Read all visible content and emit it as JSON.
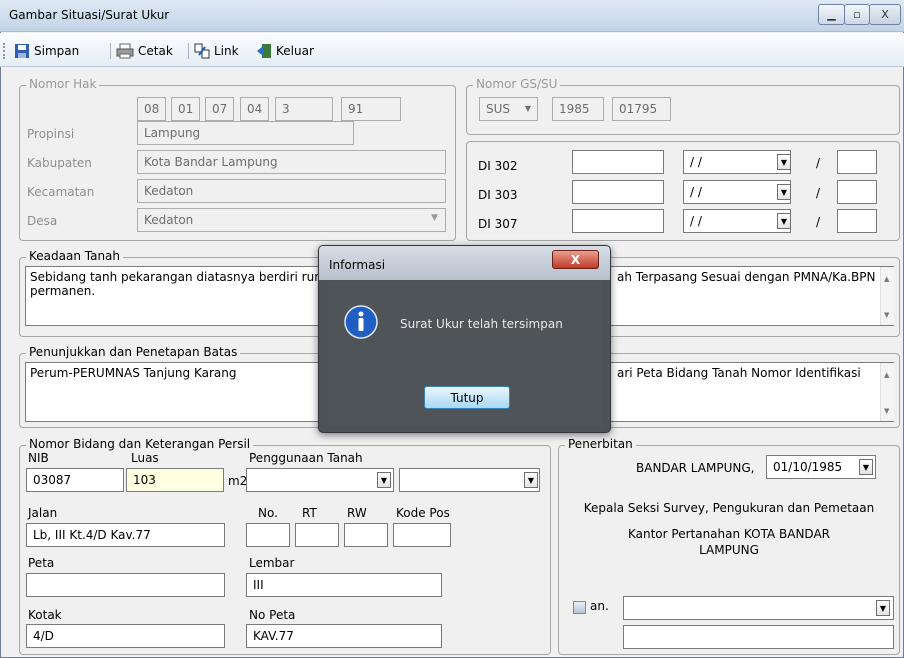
{
  "window": {
    "title": "Gambar Situasi/Surat Ukur",
    "minimize": "▁",
    "maximize": "▫",
    "close": "X"
  },
  "toolbar": {
    "simpan": "Simpan",
    "cetak": "Cetak",
    "link": "Link",
    "keluar": "Keluar"
  },
  "nomor_hak": {
    "legend": "Nomor Hak",
    "codes": [
      "08",
      "01",
      "07",
      "04",
      "3",
      "91"
    ],
    "propinsi_label": "Propinsi",
    "propinsi": "Lampung",
    "kabupaten_label": "Kabupaten",
    "kabupaten": "Kota Bandar Lampung",
    "kecamatan_label": "Kecamatan",
    "kecamatan": "Kedaton",
    "desa_label": "Desa",
    "desa": "Kedaton"
  },
  "nomor_gs": {
    "legend": "Nomor GS/SU",
    "type": "SUS",
    "year": "1985",
    "number": "01795"
  },
  "di": {
    "rows": [
      {
        "label": "DI 302",
        "date": "/ /",
        "slash": "/"
      },
      {
        "label": "DI 303",
        "date": "/ /",
        "slash": "/"
      },
      {
        "label": "DI 307",
        "date": "/ /",
        "slash": "/"
      }
    ]
  },
  "keadaan": {
    "legend": "Keadaan Tanah",
    "text": "Sebidang tanh pekarangan diatasnya berdiri rum",
    "text2": "permanen."
  },
  "tanda_batas": {
    "text": "ah Terpasang Sesuai dengan PMNA/Ka.BPN"
  },
  "penunjukkan": {
    "legend": "Penunjukkan dan Penetapan Batas",
    "text": "Perum-PERUMNAS Tanjung Karang"
  },
  "peta_bidang": {
    "text": "ari Peta Bidang Tanah Nomor Identifikasi"
  },
  "persil": {
    "legend": "Nomor Bidang dan Keterangan Persil",
    "nib_label": "NIB",
    "nib": "03087",
    "luas_label": "Luas",
    "luas": "103",
    "m2": "m2",
    "penggunaan_label": "Penggunaan Tanah",
    "jalan_label": "Jalan",
    "jalan": "Lb, III Kt.4/D Kav.77",
    "no_label": "No.",
    "rt_label": "RT",
    "rw_label": "RW",
    "kodepos_label": "Kode Pos",
    "peta_label": "Peta",
    "lembar_label": "Lembar",
    "lembar": "III",
    "kotak_label": "Kotak",
    "kotak": "4/D",
    "nopeta_label": "No Peta",
    "nopeta": "KAV.77"
  },
  "penerbitan": {
    "legend": "Penerbitan",
    "city": "BANDAR LAMPUNG,",
    "date": "01/10/1985",
    "line1": "Kepala Seksi Survey, Pengukuran dan Pemetaan",
    "line2": "Kantor Pertanahan KOTA BANDAR",
    "line3": "LAMPUNG",
    "an_label": "an."
  },
  "dialog": {
    "title": "Informasi",
    "message": "Surat Ukur telah tersimpan",
    "button": "Tutup",
    "close": "X"
  }
}
